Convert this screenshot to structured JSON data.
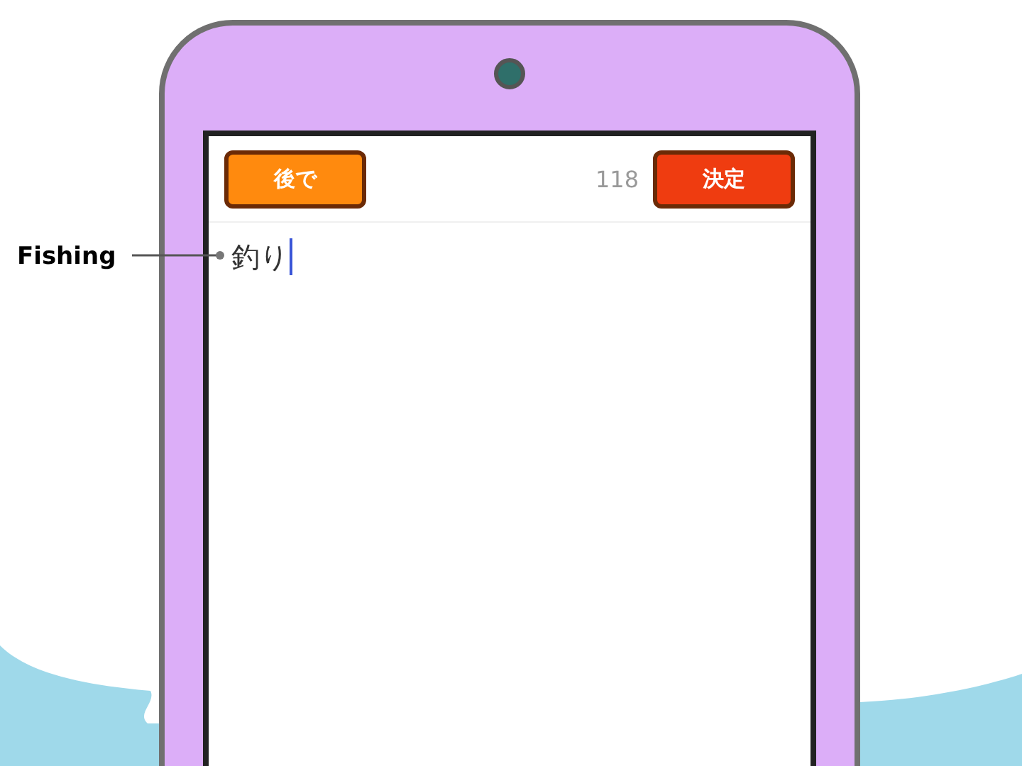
{
  "callout": {
    "label": "Fishing"
  },
  "toolbar": {
    "later_button": "後で",
    "count": "118",
    "confirm_button": "決定"
  },
  "input": {
    "value": "釣り"
  }
}
